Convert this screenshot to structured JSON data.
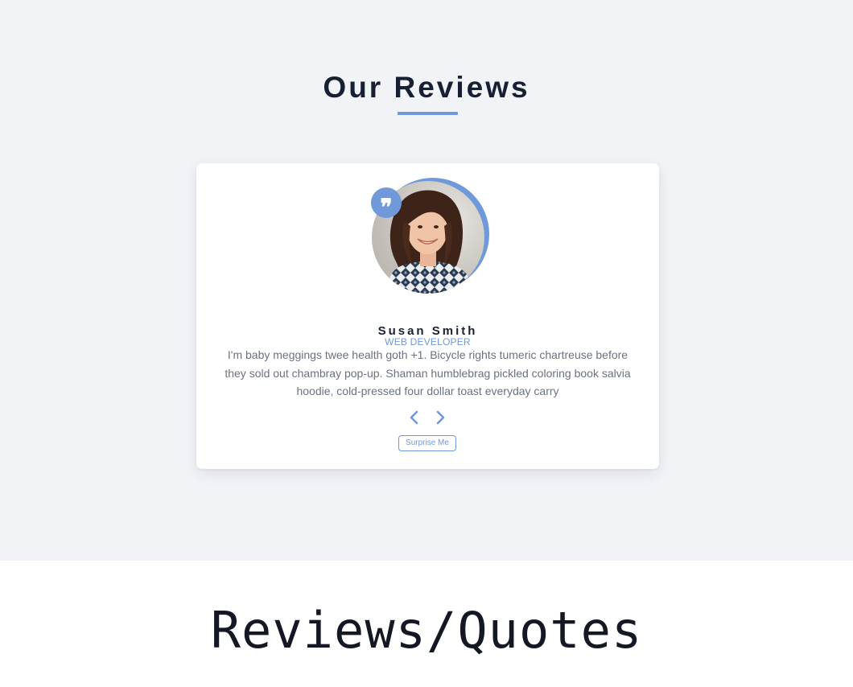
{
  "section": {
    "title": "Our Reviews",
    "accent_color": "#6f99d9"
  },
  "review": {
    "name": "Susan Smith",
    "job": "WEB DEVELOPER",
    "text": "I'm baby meggings twee health goth +1. Bicycle rights tumeric chartreuse before they sold out chambray pop-up. Shaman humblebrag pickled coloring book salvia hoodie, cold-pressed four dollar toast everyday carry",
    "quote_icon": "quote-icon"
  },
  "controls": {
    "prev_icon": "chevron-left-icon",
    "next_icon": "chevron-right-icon",
    "surprise_label": "Surprise Me"
  },
  "caption": {
    "text": "Reviews/Quotes"
  }
}
